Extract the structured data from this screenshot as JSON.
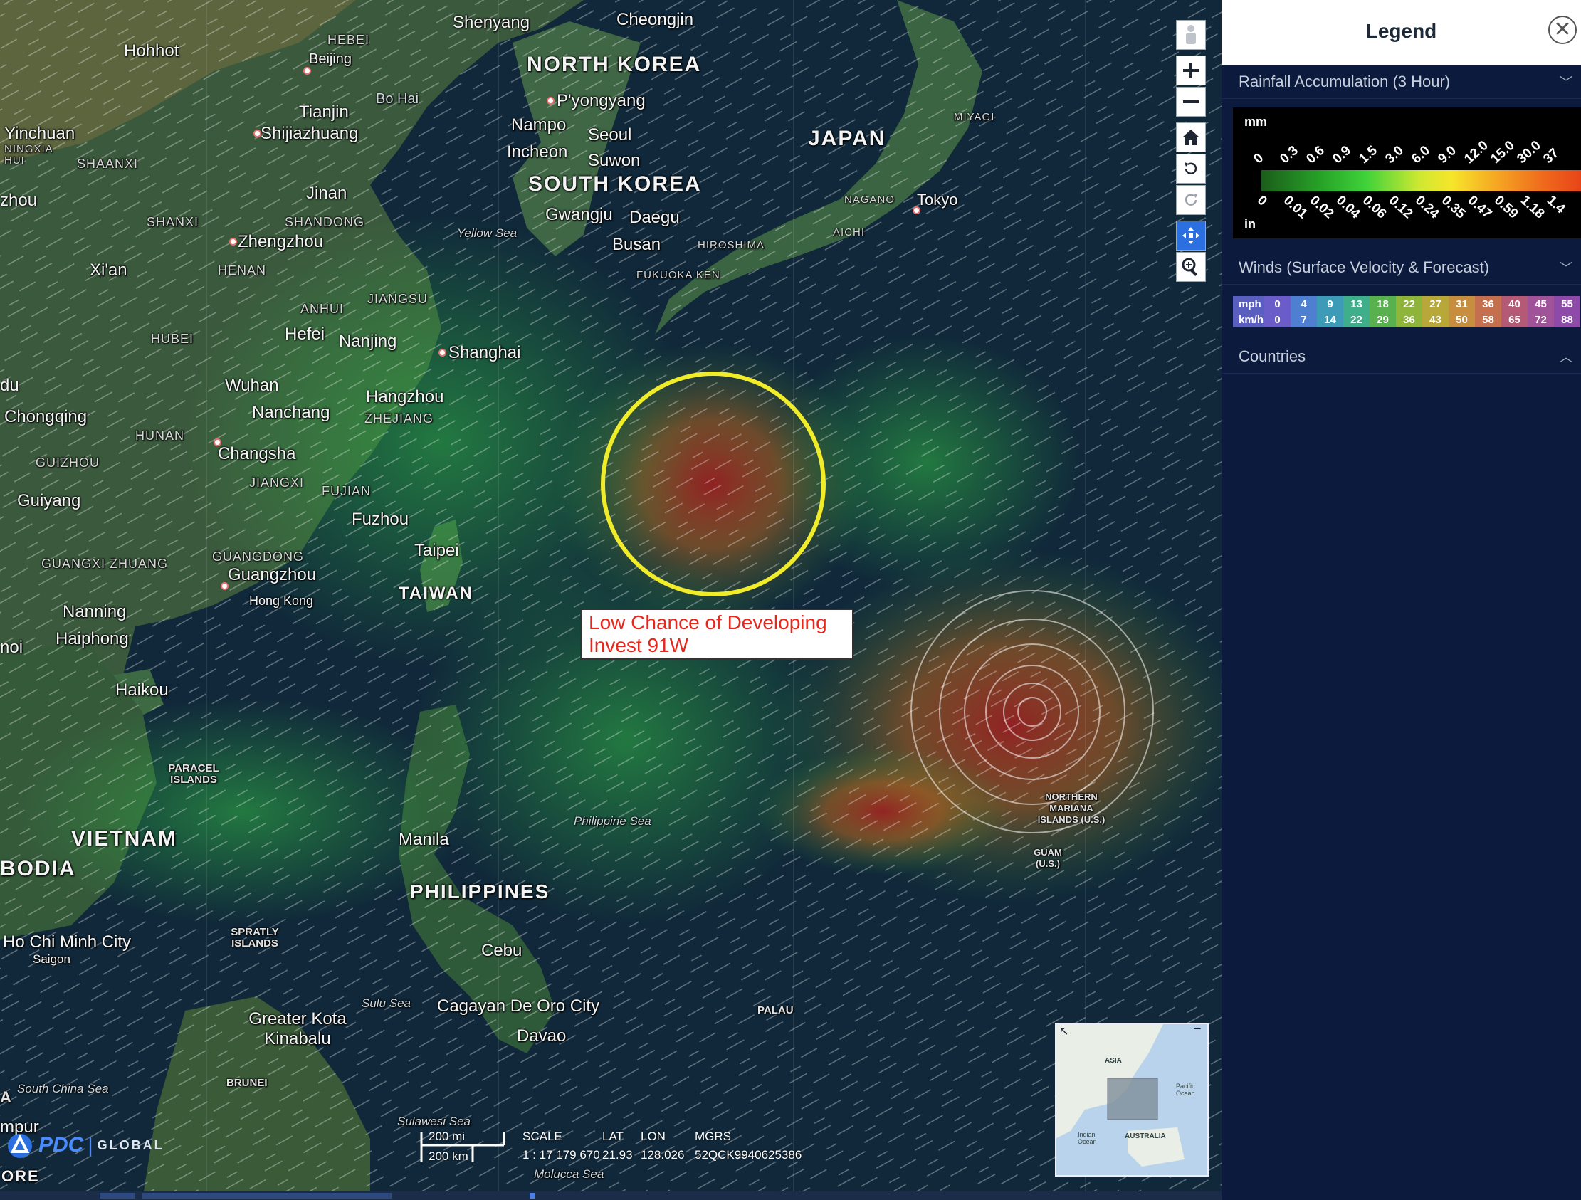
{
  "map": {
    "countries": [
      {
        "name": "NORTH KOREA"
      },
      {
        "name": "SOUTH KOREA"
      },
      {
        "name": "JAPAN"
      },
      {
        "name": "TAIWAN"
      },
      {
        "name": "VIETNAM"
      },
      {
        "name": "BODIA"
      },
      {
        "name": "PHILIPPINES"
      }
    ],
    "cities": [
      "Shenyang",
      "Cheongjin",
      "Hohhot",
      "Beijing",
      "P'yongyang",
      "Nampo",
      "Seoul",
      "Incheon",
      "Suwon",
      "Tianjin",
      "Yinchuan",
      "Shijiazhuang",
      "Jinan",
      "Gwangju",
      "Daegu",
      "Busan",
      "Tokyo",
      "Zhengzhou",
      "Xi'an",
      "Hefei",
      "Nanjing",
      "Shanghai",
      "Wuhan",
      "Hangzhou",
      "Chongqing",
      "Nanchang",
      "Changsha",
      "Guiyang",
      "Fuzhou",
      "Taipei",
      "Guangzhou",
      "Hong Kong",
      "Nanning",
      "Haiphong",
      "Haikou",
      "Manila",
      "Ho Chi Minh City",
      "Saigon",
      "Cebu",
      "Cagayan De Oro City",
      "Davao",
      "Greater Kota Kinabalu",
      "zhou",
      "du",
      "noi",
      "mpur"
    ],
    "provinces": [
      "HEBEI",
      "NINGXIA HUI",
      "SHAANXI",
      "SHANXI",
      "SHANDONG",
      "HENAN",
      "ANHUI",
      "JIANGSU",
      "HUBEI",
      "HUNAN",
      "GUIZHOU",
      "JIANGXI",
      "FUJIAN",
      "ZHEJIANG",
      "GUANGXI ZHUANG",
      "GUANGDONG",
      "HIROSHIMA",
      "FUKUOKA KEN",
      "NAGANO",
      "AICHI",
      "MIYAGI"
    ],
    "seas": [
      "Bo Hai",
      "Yellow Sea",
      "Philippine Sea",
      "Sulu Sea",
      "South China Sea",
      "Sulawesi Sea",
      "Molucca Sea"
    ],
    "islands": [
      "PARACEL ISLANDS",
      "SPRATLY ISLANDS",
      "NORTHERN MARIANA ISLANDS (U.S.)",
      "GUAM (U.S.)",
      "PALAU",
      "BRUNEI",
      "A"
    ]
  },
  "annotation": {
    "line1": "Low Chance of Developing",
    "line2": "Invest 91W"
  },
  "scale": {
    "label": "SCALE",
    "value": "1 : 17 179 670",
    "mi": "200 mi",
    "km": "200 km"
  },
  "coords": {
    "lat_label": "LAT",
    "lat": "21.93",
    "lon_label": "LON",
    "lon": "128.026",
    "mgrs_label": "MGRS",
    "mgrs": "52QCK9940625386"
  },
  "brand": {
    "name": "PDC",
    "global": "GLOBAL",
    "bottom": "ORE"
  },
  "controls": [
    {
      "name": "street-view",
      "icon": "person-icon"
    },
    {
      "name": "zoom-in",
      "icon": "plus-icon"
    },
    {
      "name": "zoom-out",
      "icon": "minus-icon"
    },
    {
      "name": "home",
      "icon": "home-icon"
    },
    {
      "name": "rotate-left",
      "icon": "rotate-ccw-icon"
    },
    {
      "name": "rotate-right",
      "icon": "rotate-cw-icon"
    },
    {
      "name": "pan",
      "icon": "pan-icon"
    },
    {
      "name": "zoom-box",
      "icon": "magnifier-icon"
    }
  ],
  "overview": {
    "asia": "ASIA",
    "pacific": "Pacific Ocean",
    "indian": "Indian Ocean",
    "australia": "AUSTRALIA"
  },
  "legend": {
    "title": "Legend",
    "rain_title": "Rainfall Accumulation (3 Hour)",
    "rain_unit_mm": "mm",
    "rain_unit_in": "in",
    "rain_mm": [
      "0",
      "0.3",
      "0.6",
      "0.9",
      "1.5",
      "3.0",
      "6.0",
      "9.0",
      "12.0",
      "15.0",
      "30.0",
      "37"
    ],
    "rain_in": [
      "0",
      "0.01",
      "0.02",
      "0.04",
      "0.06",
      "0.12",
      "0.24",
      "0.35",
      "0.47",
      "0.59",
      "1.18",
      "1.4"
    ],
    "winds_title": "Winds (Surface Velocity & Forecast)",
    "winds_mph_label": "mph",
    "winds_kmh_label": "km/h",
    "winds_mph": [
      "0",
      "4",
      "9",
      "13",
      "18",
      "22",
      "27",
      "31",
      "36",
      "40",
      "45",
      "55"
    ],
    "winds_kmh": [
      "0",
      "7",
      "14",
      "22",
      "29",
      "36",
      "43",
      "50",
      "58",
      "65",
      "72",
      "88"
    ],
    "winds_colors": [
      "#6a5cc9",
      "#4f7fd0",
      "#3d9bb8",
      "#3fae8a",
      "#58b04e",
      "#8fb43a",
      "#b8a83a",
      "#c78e3f",
      "#c4704f",
      "#b45a77",
      "#a05399",
      "#8e4aa9"
    ],
    "countries_title": "Countries"
  }
}
